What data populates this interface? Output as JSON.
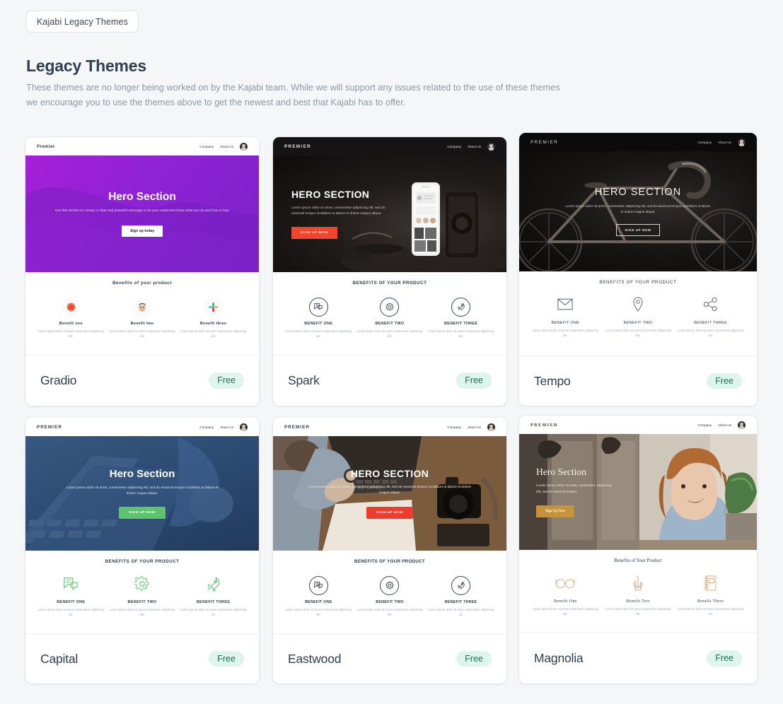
{
  "header": {
    "breadcrumb_label": "Kajabi Legacy Themes",
    "title": "Legacy Themes",
    "description": "These themes are no longer being worked on by the Kajabi team. While we will support any issues related to the use of these themes we encourage you to use the themes above to get the newest and best that Kajabi has to offer."
  },
  "common": {
    "price_label": "Free",
    "nav_company": "Company",
    "nav_about": "About Us",
    "brand": "Premier"
  },
  "themes": [
    {
      "name": "Gradio",
      "price": "Free",
      "preview": {
        "brand": "Premier",
        "nav": [
          "Company",
          "About Us"
        ],
        "hero_title": "Hero Section",
        "hero_sub": "Use this section to convey a clear and powerful message to let your customers know what you do and how to buy.",
        "cta": "Sign up today",
        "benefits_head": "Benefits of your product",
        "benefits": [
          {
            "name": "Benefit one",
            "desc": "Lorem ipsum dolor sit amet consectetur adipiscing elit.",
            "icon": "asterisk-icon"
          },
          {
            "name": "Benefit two",
            "desc": "Lorem ipsum dolor sit amet consectetur adipiscing elit.",
            "icon": "mailchimp-icon"
          },
          {
            "name": "Benefit three",
            "desc": "Lorem ipsum dolor sit amet consectetur adipiscing elit.",
            "icon": "slack-icon"
          }
        ]
      }
    },
    {
      "name": "Spark",
      "price": "Free",
      "preview": {
        "brand": "PREMIER",
        "nav": [
          "Company",
          "About Us"
        ],
        "hero_title": "HERO SECTION",
        "hero_sub": "Lorem ipsum dolor sit amet, consectetur adipiscing elit, sed do eiusmod tempor incididunt ut labore et dolore magna aliqua.",
        "cta": "SIGN UP NOW",
        "benefits_head": "BENEFITS OF YOUR PRODUCT",
        "benefits": [
          {
            "name": "BENEFIT ONE",
            "desc": "Lorem ipsum dolor sit amet consectetur adipiscing elit.",
            "icon": "chat-icon"
          },
          {
            "name": "BENEFIT TWO",
            "desc": "Lorem ipsum dolor sit amet consectetur adipiscing elit.",
            "icon": "gear-icon"
          },
          {
            "name": "BENEFIT THREE",
            "desc": "Lorem ipsum dolor sit amet consectetur adipiscing elit.",
            "icon": "rocket-icon"
          }
        ]
      }
    },
    {
      "name": "Tempo",
      "price": "Free",
      "preview": {
        "brand": "PREMIER",
        "nav": [
          "Company",
          "About Us"
        ],
        "hero_title": "HERO SECTION",
        "hero_sub": "Lorem ipsum dolor sit amet, consectetur adipiscing elit, sed do eiusmod tempor incididunt ut labore et dolore magna aliqua.",
        "cta": "SIGN UP NOW",
        "benefits_head": "BENEFITS OF YOUR PRODUCT",
        "benefits": [
          {
            "name": "BENEFIT ONE",
            "desc": "Lorem ipsum dolor sit amet consectetur adipiscing elit.",
            "icon": "envelope-icon"
          },
          {
            "name": "BENEFIT TWO",
            "desc": "Lorem ipsum dolor sit amet consectetur adipiscing elit.",
            "icon": "location-pin-icon"
          },
          {
            "name": "BENEFIT THREE",
            "desc": "Lorem ipsum dolor sit amet consectetur adipiscing elit.",
            "icon": "share-icon"
          }
        ]
      }
    },
    {
      "name": "Capital",
      "price": "Free",
      "preview": {
        "brand": "PREMIER",
        "nav": [
          "Company",
          "About Us"
        ],
        "hero_title": "Hero Section",
        "hero_sub": "Lorem ipsum dolor sit amet, consectetur adipiscing elit, sed do eiusmod tempor incididunt ut labore et dolore magna aliqua.",
        "cta": "SIGN UP NOW",
        "benefits_head": "BENEFITS OF YOUR PRODUCT",
        "benefits": [
          {
            "name": "BENEFIT ONE",
            "desc": "Lorem ipsum dolor sit amet consectetur adipiscing elit.",
            "icon": "chat-icon"
          },
          {
            "name": "BENEFIT TWO",
            "desc": "Lorem ipsum dolor sit amet consectetur adipiscing elit.",
            "icon": "gear-icon"
          },
          {
            "name": "BENEFIT THREE",
            "desc": "Lorem ipsum dolor sit amet consectetur adipiscing elit.",
            "icon": "rocket-icon"
          }
        ]
      }
    },
    {
      "name": "Eastwood",
      "price": "Free",
      "preview": {
        "brand": "PREMIER",
        "nav": [
          "Company",
          "About Us"
        ],
        "hero_title": "HERO SECTION",
        "hero_sub": "Lorem ipsum dolor sit amet, consectetur adipiscing elit, sed do eiusmod tempor incididunt ut labore et dolore magna aliqua.",
        "cta": "SIGN-UP NOW",
        "benefits_head": "BENEFITS OF YOUR PRODUCT",
        "benefits": [
          {
            "name": "BENEFIT ONE",
            "desc": "Lorem ipsum dolor sit amet consectetur adipiscing elit.",
            "icon": "chat-icon"
          },
          {
            "name": "BENEFIT TWO",
            "desc": "Lorem ipsum dolor sit amet consectetur adipiscing elit.",
            "icon": "gear-icon"
          },
          {
            "name": "BENEFIT THREE",
            "desc": "Lorem ipsum dolor sit amet consectetur adipiscing elit.",
            "icon": "rocket-icon"
          }
        ]
      }
    },
    {
      "name": "Magnolia",
      "price": "Free",
      "preview": {
        "brand": "PREMIER",
        "nav": [
          "Company",
          "About Us"
        ],
        "hero_title": "Hero Section",
        "hero_sub": "Lorem ipsum dolor sit amet, consectetur adipiscing elit, sed do eiusmod tempor.",
        "cta": "Sign Up Now",
        "benefits_head": "Benefits of Your Product",
        "benefits": [
          {
            "name": "Benefit One",
            "desc": "Lorem ipsum dolor sit amet consectetur adipiscing elit.",
            "icon": "glasses-icon"
          },
          {
            "name": "Benefit Two",
            "desc": "Lorem ipsum dolor sit amet consectetur adipiscing elit.",
            "icon": "cactus-icon"
          },
          {
            "name": "Benefit Three",
            "desc": "Lorem ipsum dolor sit amet consectetur adipiscing elit.",
            "icon": "notebook-icon"
          }
        ]
      }
    }
  ],
  "colors": {
    "page_bg": "#f5f6f8",
    "badge_bg": "#ddf5ec",
    "badge_text": "#1e6f54",
    "gradio_purple": "#9b1fd6",
    "spark_red": "#f04e32",
    "capital_green": "#5cc46c",
    "capital_blue": "#2d4a72",
    "eastwood_red": "#ed3c2e",
    "magnolia_gold": "#c79339"
  }
}
